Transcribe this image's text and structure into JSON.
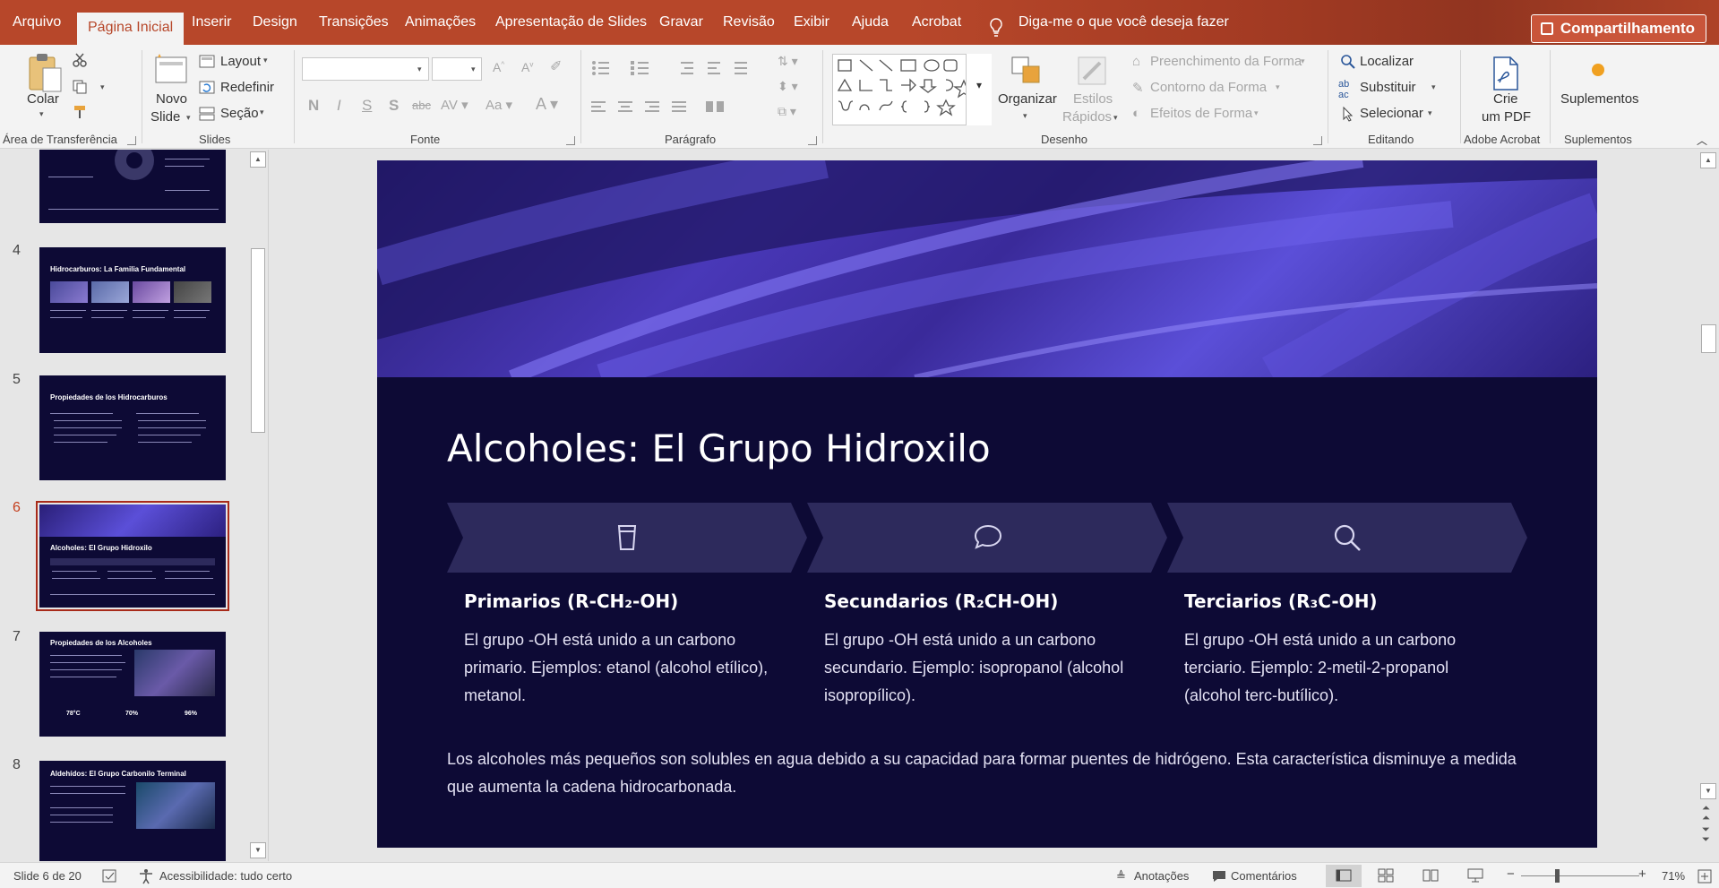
{
  "menu": {
    "tabs": [
      "Arquivo",
      "Página Inicial",
      "Inserir",
      "Design",
      "Transições",
      "Animações",
      "Apresentação de Slides",
      "Gravar",
      "Revisão",
      "Exibir",
      "Ajuda",
      "Acrobat"
    ],
    "active_tab": "Página Inicial",
    "tell_me": "Diga-me o que você deseja fazer",
    "share": "Compartilhamento"
  },
  "ribbon": {
    "clipboard": {
      "paste": "Colar",
      "label": "Área de Transferência"
    },
    "slides": {
      "new_slide_1": "Novo",
      "new_slide_2": "Slide",
      "layout": "Layout",
      "reset": "Redefinir",
      "section": "Seção",
      "label": "Slides"
    },
    "font": {
      "label": "Fonte"
    },
    "paragraph": {
      "label": "Parágrafo"
    },
    "drawing": {
      "arrange": "Organizar",
      "quick_styles_1": "Estilos",
      "quick_styles_2": "Rápidos",
      "shape_fill": "Preenchimento da Forma",
      "shape_outline": "Contorno da Forma",
      "shape_effects": "Efeitos de Forma",
      "label": "Desenho"
    },
    "editing": {
      "find": "Localizar",
      "replace": "Substituir",
      "select": "Selecionar",
      "label": "Editando"
    },
    "acrobat": {
      "create_pdf_1": "Crie",
      "create_pdf_2": "um PDF",
      "label": "Adobe Acrobat"
    },
    "addins": {
      "addins": "Suplementos",
      "label": "Suplementos"
    }
  },
  "thumbnails": [
    {
      "num": "",
      "title": ""
    },
    {
      "num": "4",
      "title": "Hidrocarburos: La Familia Fundamental"
    },
    {
      "num": "5",
      "title": "Propiedades de los Hidrocarburos"
    },
    {
      "num": "6",
      "title": "Alcoholes: El Grupo Hidroxilo"
    },
    {
      "num": "7",
      "title": "Propiedades de los Alcoholes",
      "stats": [
        "78°C",
        "70%",
        "96%"
      ]
    },
    {
      "num": "8",
      "title": "Aldehídos: El Grupo Carbonilo Terminal"
    }
  ],
  "slide": {
    "title": "Alcoholes: El Grupo Hidroxilo",
    "columns": [
      {
        "icon": "cup-icon",
        "heading": "Primarios (R-CH₂-OH)",
        "body": "El grupo -OH está unido a un carbono primario. Ejemplos: etanol (alcohol etílico), metanol."
      },
      {
        "icon": "chat-bubble-icon",
        "heading": "Secundarios (R₂CH-OH)",
        "body": "El grupo -OH está unido a un carbono secundario. Ejemplo: isopropanol (alcohol isopropílico)."
      },
      {
        "icon": "search-icon",
        "heading": "Terciarios (R₃C-OH)",
        "body": "El grupo -OH está unido a un carbono terciario. Ejemplo: 2-metil-2-propanol (alcohol terc-butílico)."
      }
    ],
    "footer": "Los alcoholes más pequeños son solubles en agua debido a su capacidad para formar puentes de hidrógeno. Esta característica disminuye a medida que aumenta la cadena hidrocarbonada."
  },
  "status": {
    "slide_counter": "Slide 6 de 20",
    "accessibility": "Acessibilidade: tudo certo",
    "notes": "Anotações",
    "comments": "Comentários",
    "zoom": "71%"
  },
  "colors": {
    "accent": "#b7472a",
    "slide_bg": "#0d0a35",
    "chevron": "#2d2a5c"
  }
}
